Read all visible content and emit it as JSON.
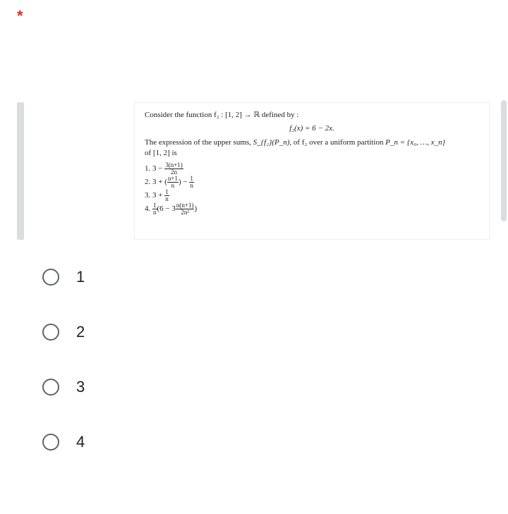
{
  "required_marker": "*",
  "problem": {
    "line1": "Consider the function f₂ : [1, 2] → ℝ defined by :",
    "eq": "f₂(x) = 6 − 2x.",
    "line3_a": "The expression of the upper sums, ",
    "sfn": "S_{f₂}(P_n)",
    "line3_b": ", of f₂ over a uniform partition ",
    "pn": "P_n = {x₀, …, x_n}",
    "line4": "of [1, 2] is",
    "items": {
      "i1_pre": "1.  3 − ",
      "i1_num": "3(n+1)",
      "i1_den": "2n",
      "i2_pre": "2.  3 + (",
      "i2_num1": "n+1",
      "i2_den1": "n",
      "i2_mid": ") − ",
      "i2_num2": "1",
      "i2_den2": "n",
      "i3": "3.  3 + ",
      "i3_num": "1",
      "i3_den": "n",
      "i4_pre": "4.  ",
      "i4_num1": "1",
      "i4_den1": "n",
      "i4_mid": "(6 − 3",
      "i4_num2": "n(n+1)",
      "i4_den2": "2n²",
      "i4_post": ")"
    }
  },
  "options": [
    {
      "label": "1"
    },
    {
      "label": "2"
    },
    {
      "label": "3"
    },
    {
      "label": "4"
    }
  ]
}
